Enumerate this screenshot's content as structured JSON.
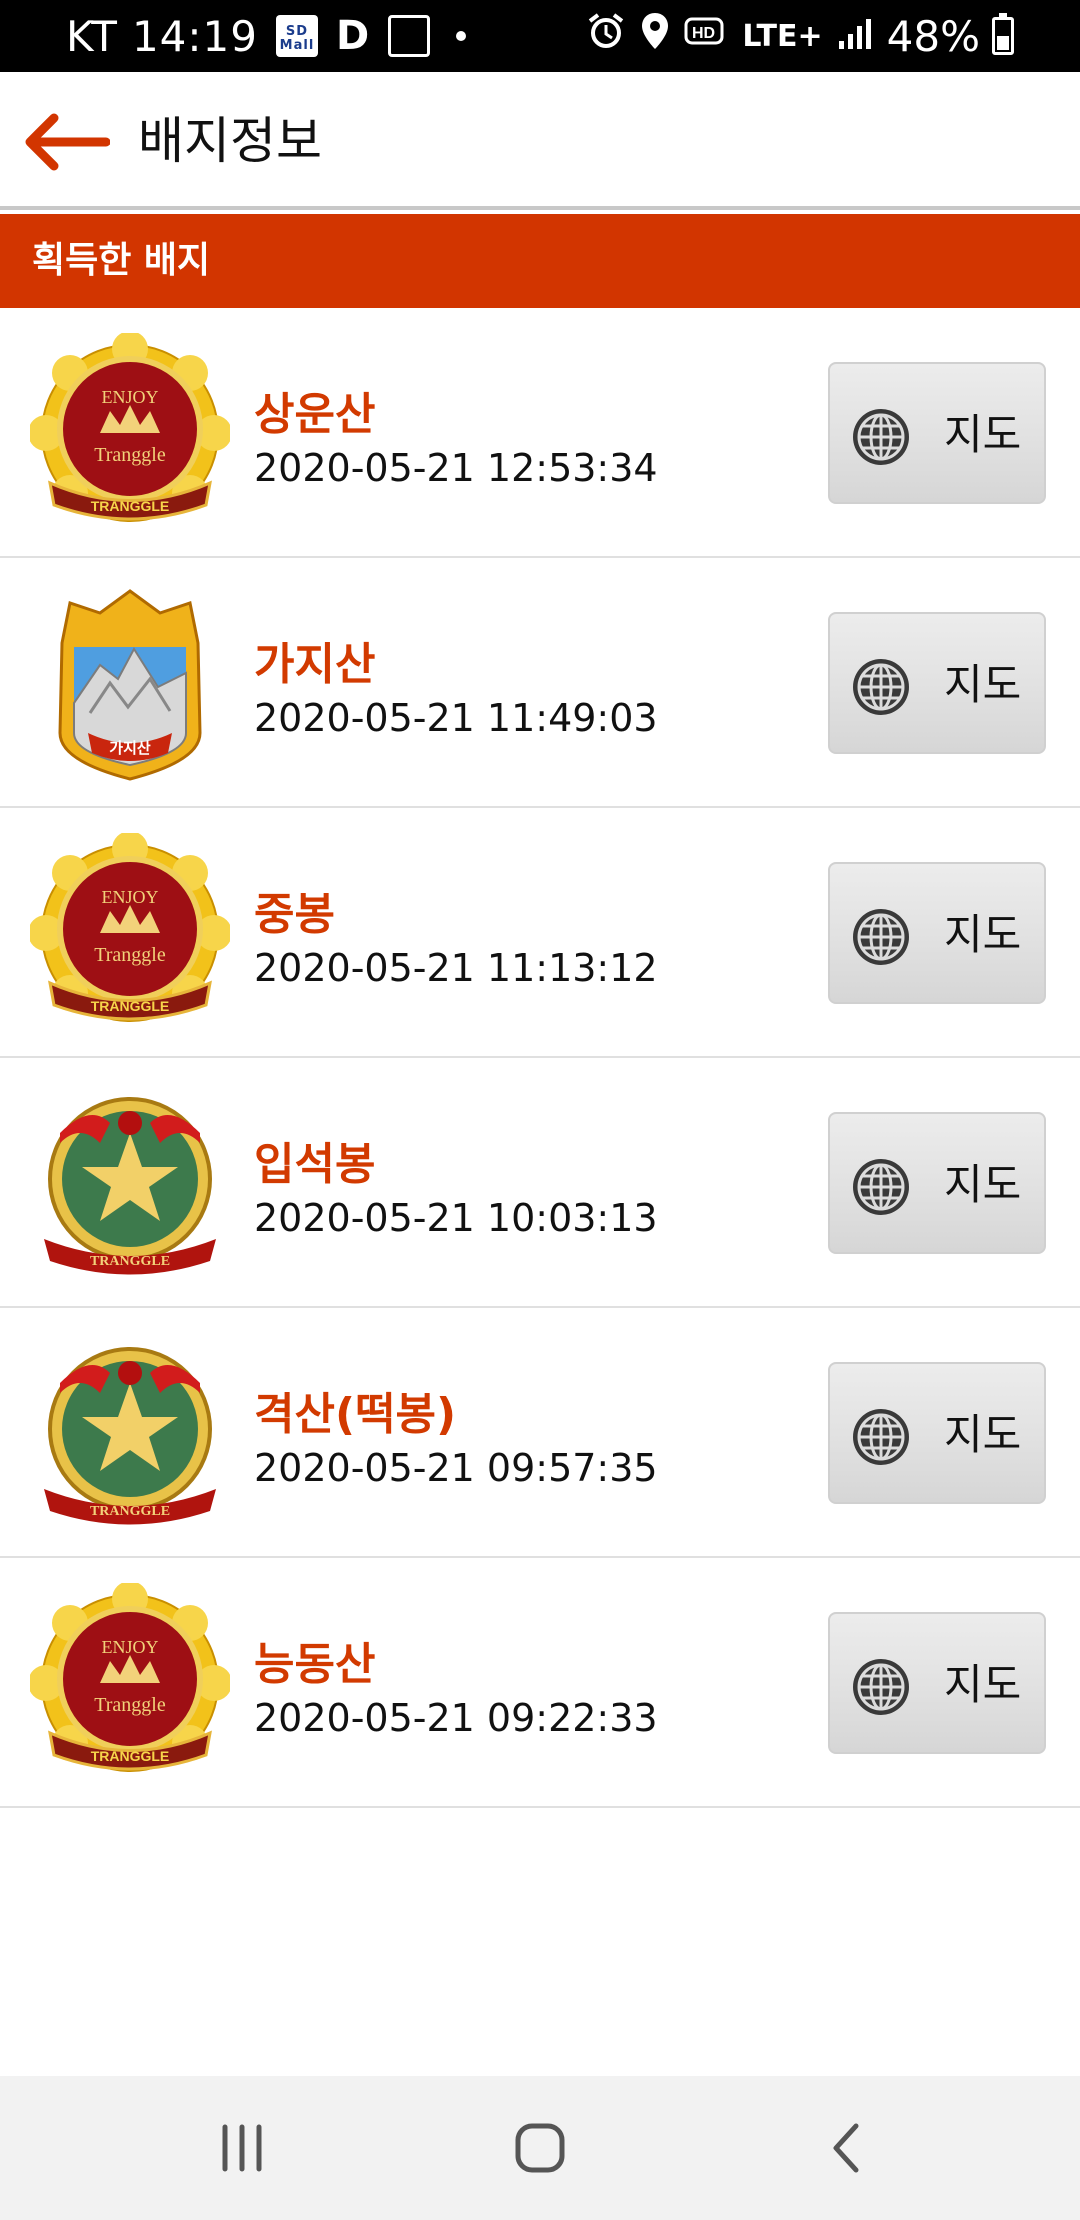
{
  "status_bar": {
    "carrier": "KT",
    "time": "14:19",
    "sdmall_label": "SD Mall",
    "network": "LTE+",
    "battery": "48%"
  },
  "app_bar": {
    "title": "배지정보"
  },
  "section": {
    "title": "획득한 배지"
  },
  "badges": [
    {
      "name": "상운산",
      "datetime": "2020-05-21 12:53:34",
      "badge_type": "gold-enjoy",
      "map_label": "지도"
    },
    {
      "name": "가지산",
      "datetime": "2020-05-21 11:49:03",
      "badge_type": "mountain-shield",
      "badge_caption": "가지산",
      "map_label": "지도"
    },
    {
      "name": "중봉",
      "datetime": "2020-05-21 11:13:12",
      "badge_type": "gold-enjoy",
      "map_label": "지도"
    },
    {
      "name": "입석봉",
      "datetime": "2020-05-21 10:03:13",
      "badge_type": "green-star",
      "map_label": "지도"
    },
    {
      "name": "격산(떡봉)",
      "datetime": "2020-05-21 09:57:35",
      "badge_type": "green-star",
      "map_label": "지도"
    },
    {
      "name": "능동산",
      "datetime": "2020-05-21 09:22:33",
      "badge_type": "gold-enjoy",
      "map_label": "지도"
    }
  ],
  "badge_text": {
    "enjoy": "ENJOY",
    "tranggle": "Tranggle",
    "ribbon": "TRANGGLE"
  },
  "icons": {
    "back": "arrow-left-icon",
    "map": "globe-icon",
    "nav_recents": "recents-icon",
    "nav_home": "home-icon",
    "nav_back": "chevron-left-icon"
  },
  "colors": {
    "accent": "#d23500",
    "badge_name": "#d23a00"
  }
}
